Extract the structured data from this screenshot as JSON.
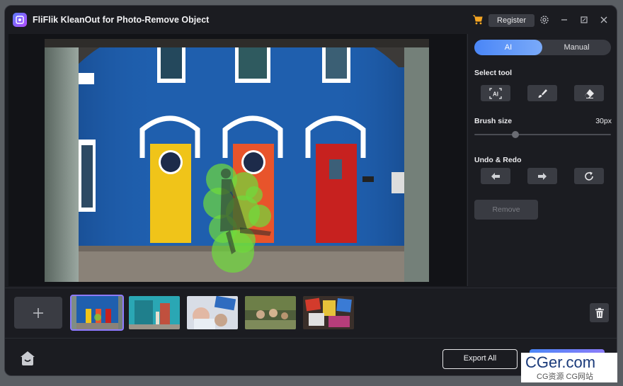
{
  "app": {
    "title": "FliFlik KleanOut for Photo-Remove Object"
  },
  "titlebar": {
    "register_label": "Register"
  },
  "panel": {
    "mode_ai": "AI",
    "mode_manual": "Manual",
    "select_tool_label": "Select tool",
    "brush_size_label": "Brush size",
    "brush_size_value": "30px",
    "brush_size_level": 0.3,
    "undo_redo_label": "Undo & Redo",
    "remove_label": "Remove"
  },
  "bottombar": {
    "export_all_label": "Export All"
  },
  "watermark": {
    "line1": "CGer.com",
    "line2": "CG资源 CG网站"
  },
  "colors": {
    "accent": "#4a86f7",
    "selected_thumb": "#8e7bff",
    "mask_green": "#6fdc3c"
  }
}
